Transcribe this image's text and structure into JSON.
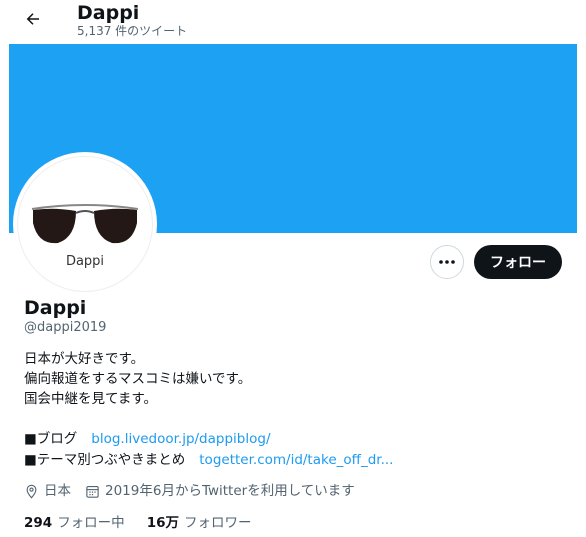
{
  "header": {
    "title": "Dappi",
    "tweet_count": "5,137 件のツイート",
    "back_icon": "arrow-left-icon"
  },
  "colors": {
    "banner": "#1da1f2",
    "link": "#1d9bf0",
    "follow_bg": "#0f1419"
  },
  "avatar": {
    "text": "Dappi"
  },
  "actions": {
    "more_icon": "more-horizontal-icon",
    "follow_label": "フォロー"
  },
  "profile": {
    "name": "Dappi",
    "handle": "@dappi2019",
    "bio": [
      "日本が大好きです。",
      "偏向報道をするマスコミは嫌いです。",
      "国会中継を見てます。"
    ],
    "links": [
      {
        "label": "■ブログ",
        "url": "blog.livedoor.jp/dappiblog/"
      },
      {
        "label": "■テーマ別つぶやきまとめ",
        "url": "togetter.com/id/take_off_dr..."
      }
    ],
    "location": "日本",
    "location_icon": "location-pin-icon",
    "joined": "2019年6月からTwitterを利用しています",
    "joined_icon": "calendar-icon",
    "following_count": "294",
    "following_label": "フォロー中",
    "followers_count": "16万",
    "followers_label": "フォロワー"
  }
}
